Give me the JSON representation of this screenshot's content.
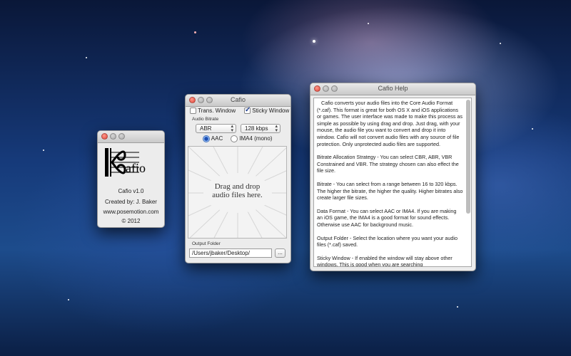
{
  "about": {
    "logo_text": "afio",
    "app_name": "Cafio v1.0",
    "created_by": "Created by: J. Baker",
    "website": "www.posemotion.com",
    "copyright": "© 2012"
  },
  "main": {
    "title": "Cafio",
    "trans_window_label": "Trans. Window",
    "trans_window_checked": false,
    "sticky_window_label": "Sticky Window",
    "sticky_window_checked": true,
    "bitrate_section_label": "Audio Bitrate",
    "strategy_value": "ABR",
    "bitrate_value": "128 kbps",
    "format_aac_label": "AAC",
    "format_ima4_label": "IMA4 (mono)",
    "format_selected": "AAC",
    "drop_line1": "Drag and drop",
    "drop_line2": "audio files here.",
    "output_section_label": "Output Folder",
    "output_path": "/Users/jbaker/Desktop/",
    "browse_label": "..."
  },
  "help": {
    "title": "Cafio Help",
    "paragraphs": [
      "   Cafio converts your audio files into the Core Audio Format (*.caf). This format is great for both OS X and iOS applications or games. The user interface was made to make this process as simple as possible by using drag and drop. Just drag, with your mouse, the audio file you want to convert and drop it into window. Cafio will not convert audio files with any source of file protection. Only unprotected audio files are supported.",
      "Bitrate Allocation Strategy - You can select CBR, ABR, VBR Constrained and VBR. The strategy chosen can also effect the file size.",
      "Bitrate - You can select from a range between 16 to 320 kbps. The higher the bitrate, the higher the quality. Higher bitrates also create larger file sizes.",
      "Data Format - You can select AAC or IMA4. If you are making an iOS game, the IMA4 is a good format for sound effects. Otherwise use AAC for background music.",
      "Output Folder - Select the location where you want your audio files (*.caf) saved.",
      "Sticky Window - If enabled the window will stay above other windows. This is good when you are searching"
    ]
  }
}
